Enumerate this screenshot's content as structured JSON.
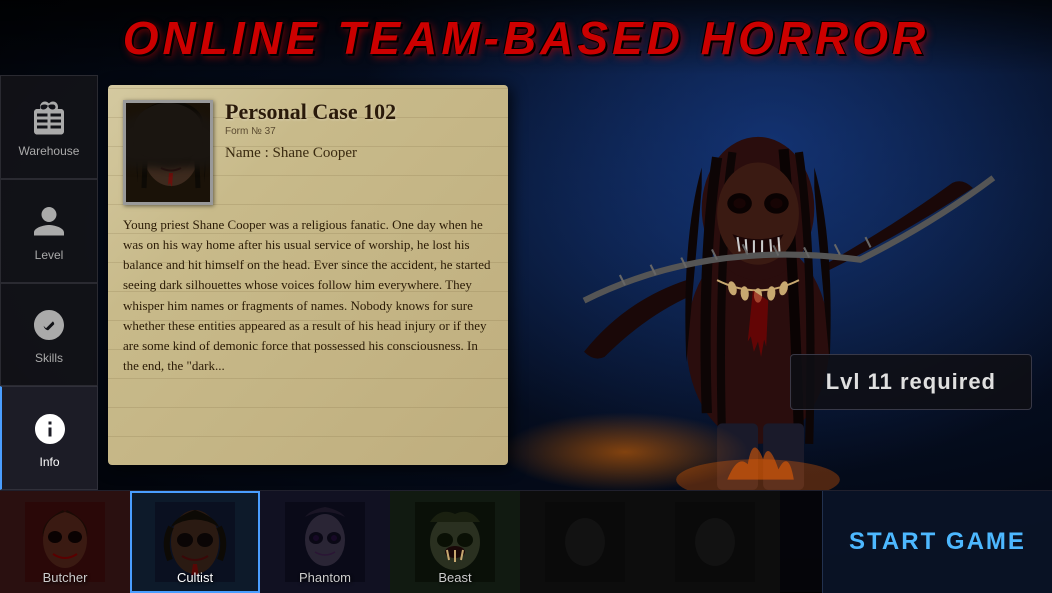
{
  "title": "ONLINE TEAM-BASED HORROR",
  "sidebar": {
    "items": [
      {
        "id": "warehouse",
        "label": "Warehouse",
        "icon": "backpack"
      },
      {
        "id": "level",
        "label": "Level",
        "icon": "person"
      },
      {
        "id": "skills",
        "label": "Skills",
        "icon": "gear"
      },
      {
        "id": "info",
        "label": "Info",
        "icon": "info",
        "active": true
      }
    ]
  },
  "case": {
    "title": "Personal Case 102",
    "form_number": "Form № 37",
    "name_label": "Name : Shane Cooper",
    "body": "Young priest Shane Cooper was a religious fanatic. One day when he was on his way home after his usual service of worship, he lost his balance and hit himself on the head. Ever since the accident, he started seeing dark silhouettes whose voices follow him everywhere. They whisper him names or fragments of names. Nobody knows for sure whether these entities appeared as a result of his head injury or if they are some kind of demonic force that possessed his consciousness. In the end, the \"dark..."
  },
  "level_badge": {
    "text": "Lvl 11 required"
  },
  "characters": [
    {
      "id": "butcher",
      "label": "Butcher",
      "active": false,
      "color": "#3a1a1a"
    },
    {
      "id": "cultist",
      "label": "Cultist",
      "active": true,
      "color": "#1a2a3a"
    },
    {
      "id": "phantom",
      "label": "Phantom",
      "active": false,
      "color": "#1a1a2a"
    },
    {
      "id": "beast",
      "label": "Beast",
      "active": false,
      "color": "#1a2a1a"
    },
    {
      "id": "char5",
      "label": "",
      "active": false,
      "color": "#1a1a1a"
    },
    {
      "id": "char6",
      "label": "",
      "active": false,
      "color": "#1a1a1a"
    }
  ],
  "start_button": {
    "label": "START GAME"
  }
}
